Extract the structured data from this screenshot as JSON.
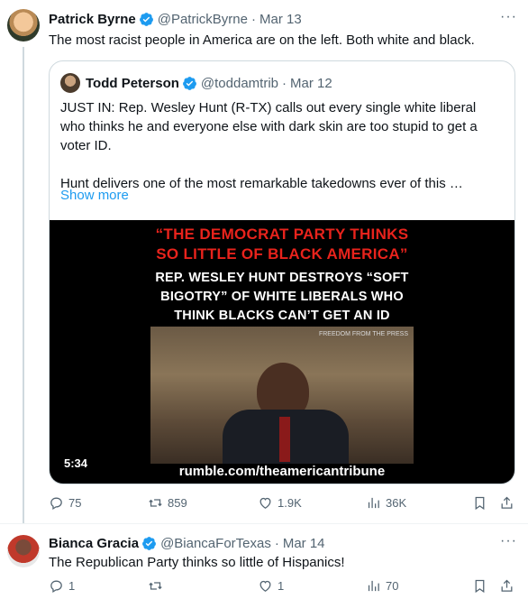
{
  "tweets": [
    {
      "author_name": "Patrick Byrne",
      "author_handle": "@PatrickByrne",
      "date": "Mar 13",
      "text": "The most racist people in America are on the left. Both white and black.",
      "quote": {
        "author_name": "Todd Peterson",
        "author_handle": "@toddamtrib",
        "date": "Mar 12",
        "paragraph1": "JUST IN: Rep. Wesley Hunt (R-TX) calls out every single white liberal who thinks he and everyone else with dark skin are too stupid to get a voter ID.",
        "paragraph2": "Hunt delivers one of the most remarkable takedowns ever of this …",
        "show_more": "Show more",
        "video": {
          "red_line1": "“THE DEMOCRAT PARTY THINKS",
          "red_line2": "SO LITTLE OF BLACK AMERICA”",
          "white_line1": "REP. WESLEY HUNT DESTROYS “SOFT",
          "white_line2": "BIGOTRY” OF WHITE LIBERALS WHO",
          "white_line3": "THINK BLACKS CAN’T GET AN ID",
          "watermark": "FREEDOM FROM THE PRESS",
          "duration": "5:34",
          "url": "rumble.com/theamericantribune"
        }
      },
      "stats": {
        "replies": "75",
        "reposts": "859",
        "likes": "1.9K",
        "views": "36K"
      }
    },
    {
      "author_name": "Bianca Gracia",
      "author_handle": "@BiancaForTexas",
      "date": "Mar 14",
      "text": "The Republican Party thinks so little of Hispanics!",
      "stats": {
        "replies": "1",
        "reposts": "",
        "likes": "1",
        "views": "70"
      }
    }
  ],
  "ui": {
    "separator": "·",
    "more_glyph": "···"
  },
  "colors": {
    "accent": "#1d9bf0",
    "secondary_text": "#536471",
    "video_red": "#e8231c"
  },
  "icons": [
    "verified-badge-icon",
    "more-icon",
    "reply-icon",
    "repost-icon",
    "like-icon",
    "views-icon",
    "bookmark-icon",
    "share-icon"
  ]
}
